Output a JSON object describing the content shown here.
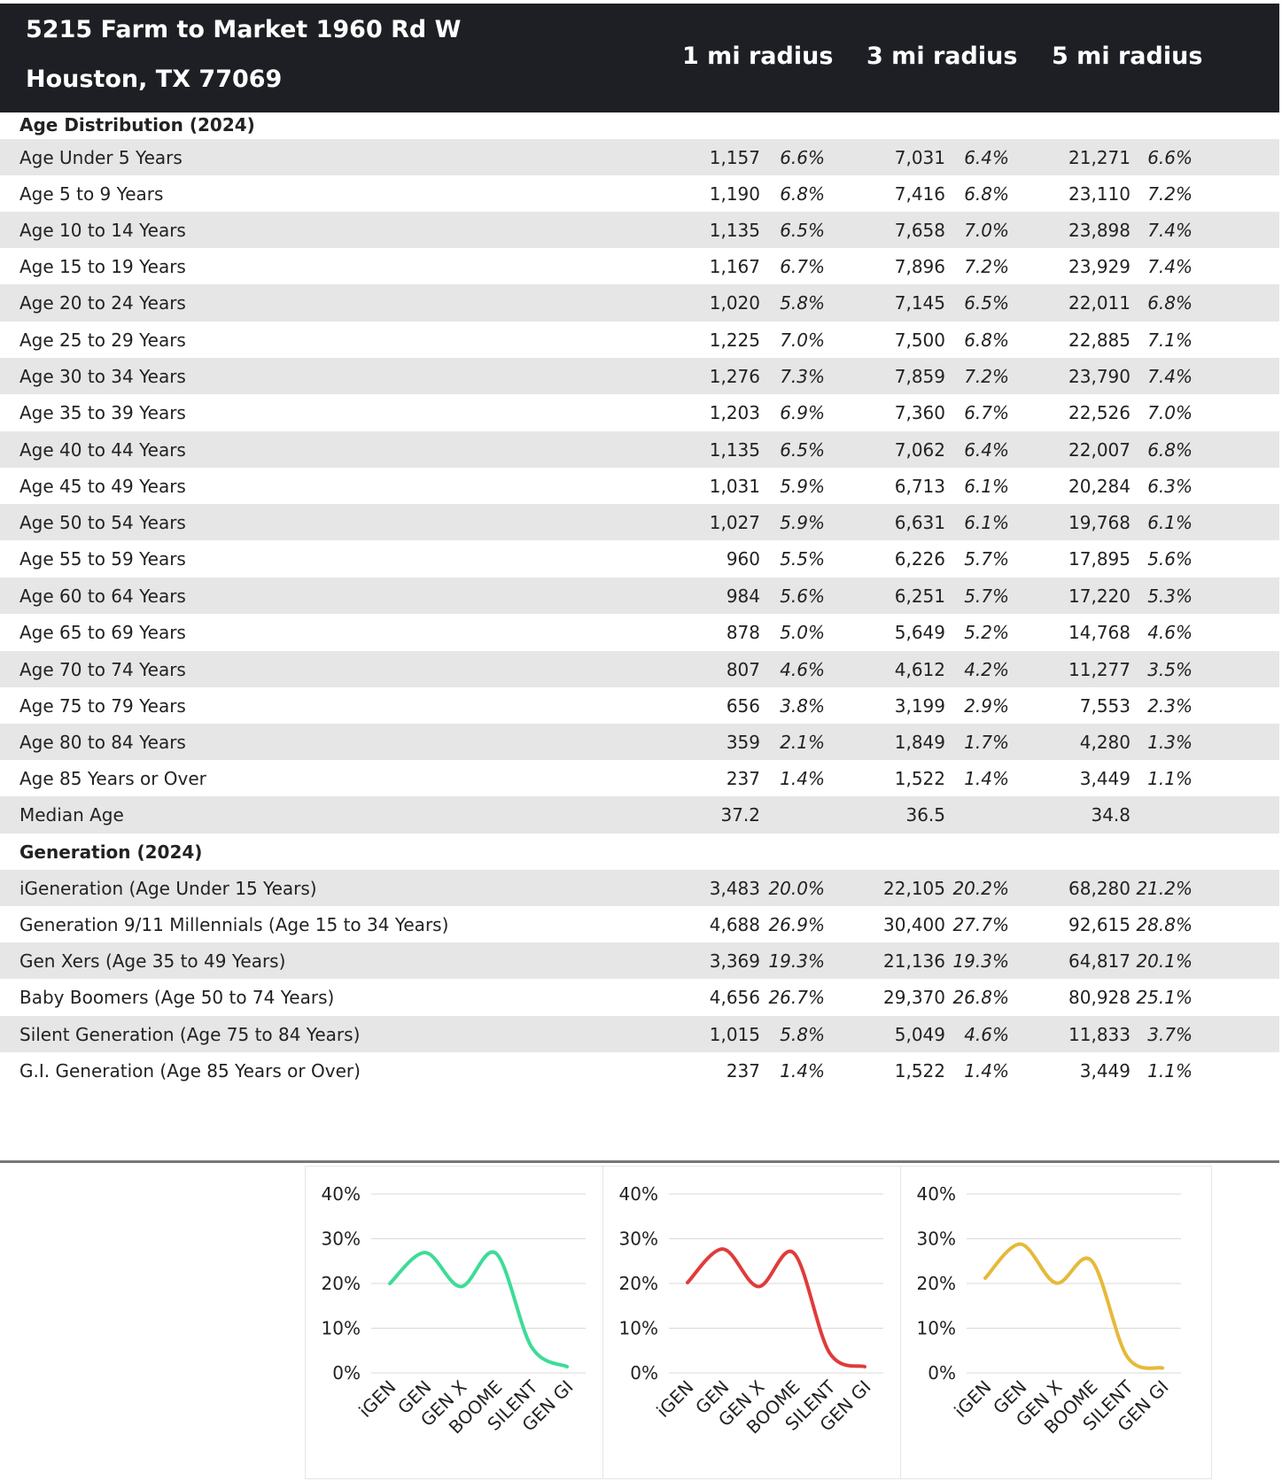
{
  "header": {
    "address_line1": "5215 Farm to Market 1960 Rd W",
    "address_line2": "Houston, TX 77069",
    "columns": [
      "1 mi radius",
      "3 mi radius",
      "5 mi radius"
    ]
  },
  "sections": [
    {
      "title": "Age Distribution (2024)",
      "rows": [
        {
          "label": "Age Under 5 Years",
          "values": [
            [
              "1,157",
              "6.6%"
            ],
            [
              "7,031",
              "6.4%"
            ],
            [
              "21,271",
              "6.6%"
            ]
          ]
        },
        {
          "label": "Age 5 to 9 Years",
          "values": [
            [
              "1,190",
              "6.8%"
            ],
            [
              "7,416",
              "6.8%"
            ],
            [
              "23,110",
              "7.2%"
            ]
          ]
        },
        {
          "label": "Age 10 to 14 Years",
          "values": [
            [
              "1,135",
              "6.5%"
            ],
            [
              "7,658",
              "7.0%"
            ],
            [
              "23,898",
              "7.4%"
            ]
          ]
        },
        {
          "label": "Age 15 to 19 Years",
          "values": [
            [
              "1,167",
              "6.7%"
            ],
            [
              "7,896",
              "7.2%"
            ],
            [
              "23,929",
              "7.4%"
            ]
          ]
        },
        {
          "label": "Age 20 to 24 Years",
          "values": [
            [
              "1,020",
              "5.8%"
            ],
            [
              "7,145",
              "6.5%"
            ],
            [
              "22,011",
              "6.8%"
            ]
          ]
        },
        {
          "label": "Age 25 to 29 Years",
          "values": [
            [
              "1,225",
              "7.0%"
            ],
            [
              "7,500",
              "6.8%"
            ],
            [
              "22,885",
              "7.1%"
            ]
          ]
        },
        {
          "label": "Age 30 to 34 Years",
          "values": [
            [
              "1,276",
              "7.3%"
            ],
            [
              "7,859",
              "7.2%"
            ],
            [
              "23,790",
              "7.4%"
            ]
          ]
        },
        {
          "label": "Age 35 to 39 Years",
          "values": [
            [
              "1,203",
              "6.9%"
            ],
            [
              "7,360",
              "6.7%"
            ],
            [
              "22,526",
              "7.0%"
            ]
          ]
        },
        {
          "label": "Age 40 to 44 Years",
          "values": [
            [
              "1,135",
              "6.5%"
            ],
            [
              "7,062",
              "6.4%"
            ],
            [
              "22,007",
              "6.8%"
            ]
          ]
        },
        {
          "label": "Age 45 to 49 Years",
          "values": [
            [
              "1,031",
              "5.9%"
            ],
            [
              "6,713",
              "6.1%"
            ],
            [
              "20,284",
              "6.3%"
            ]
          ]
        },
        {
          "label": "Age 50 to 54 Years",
          "values": [
            [
              "1,027",
              "5.9%"
            ],
            [
              "6,631",
              "6.1%"
            ],
            [
              "19,768",
              "6.1%"
            ]
          ]
        },
        {
          "label": "Age 55 to 59 Years",
          "values": [
            [
              "960",
              "5.5%"
            ],
            [
              "6,226",
              "5.7%"
            ],
            [
              "17,895",
              "5.6%"
            ]
          ]
        },
        {
          "label": "Age 60 to 64 Years",
          "values": [
            [
              "984",
              "5.6%"
            ],
            [
              "6,251",
              "5.7%"
            ],
            [
              "17,220",
              "5.3%"
            ]
          ]
        },
        {
          "label": "Age 65 to 69 Years",
          "values": [
            [
              "878",
              "5.0%"
            ],
            [
              "5,649",
              "5.2%"
            ],
            [
              "14,768",
              "4.6%"
            ]
          ]
        },
        {
          "label": "Age 70 to 74 Years",
          "values": [
            [
              "807",
              "4.6%"
            ],
            [
              "4,612",
              "4.2%"
            ],
            [
              "11,277",
              "3.5%"
            ]
          ]
        },
        {
          "label": "Age 75 to 79 Years",
          "values": [
            [
              "656",
              "3.8%"
            ],
            [
              "3,199",
              "2.9%"
            ],
            [
              "7,553",
              "2.3%"
            ]
          ]
        },
        {
          "label": "Age 80 to 84 Years",
          "values": [
            [
              "359",
              "2.1%"
            ],
            [
              "1,849",
              "1.7%"
            ],
            [
              "4,280",
              "1.3%"
            ]
          ]
        },
        {
          "label": "Age 85 Years or Over",
          "values": [
            [
              "237",
              "1.4%"
            ],
            [
              "1,522",
              "1.4%"
            ],
            [
              "3,449",
              "1.1%"
            ]
          ]
        },
        {
          "label": "Median Age",
          "values": [
            [
              "37.2",
              ""
            ],
            [
              "36.5",
              ""
            ],
            [
              "34.8",
              ""
            ]
          ]
        }
      ]
    },
    {
      "title": "Generation (2024)",
      "rows": [
        {
          "label": "iGeneration (Age Under 15 Years)",
          "values": [
            [
              "3,483",
              "20.0%"
            ],
            [
              "22,105",
              "20.2%"
            ],
            [
              "68,280",
              "21.2%"
            ]
          ]
        },
        {
          "label": "Generation 9/11 Millennials (Age 15 to 34 Years)",
          "values": [
            [
              "4,688",
              "26.9%"
            ],
            [
              "30,400",
              "27.7%"
            ],
            [
              "92,615",
              "28.8%"
            ]
          ]
        },
        {
          "label": "Gen Xers (Age 35 to 49 Years)",
          "values": [
            [
              "3,369",
              "19.3%"
            ],
            [
              "21,136",
              "19.3%"
            ],
            [
              "64,817",
              "20.1%"
            ]
          ]
        },
        {
          "label": "Baby Boomers (Age 50 to 74 Years)",
          "values": [
            [
              "4,656",
              "26.7%"
            ],
            [
              "29,370",
              "26.8%"
            ],
            [
              "80,928",
              "25.1%"
            ]
          ]
        },
        {
          "label": "Silent Generation (Age 75 to 84 Years)",
          "values": [
            [
              "1,015",
              "5.8%"
            ],
            [
              "5,049",
              "4.6%"
            ],
            [
              "11,833",
              "3.7%"
            ]
          ]
        },
        {
          "label": "G.I. Generation (Age 85 Years or Over)",
          "values": [
            [
              "237",
              "1.4%"
            ],
            [
              "1,522",
              "1.4%"
            ],
            [
              "3,449",
              "1.1%"
            ]
          ]
        }
      ]
    }
  ],
  "chart_data": [
    {
      "type": "line",
      "categories": [
        "iGEN",
        "GEN",
        "GEN X",
        "BOOME",
        "SILENT",
        "GEN GI"
      ],
      "values": [
        20.0,
        26.9,
        19.3,
        26.7,
        5.8,
        1.4
      ],
      "ylim": [
        0,
        40
      ],
      "yticks": [
        "0%",
        "10%",
        "20%",
        "30%",
        "40%"
      ],
      "color": "#3ddc97",
      "grid": true
    },
    {
      "type": "line",
      "categories": [
        "iGEN",
        "GEN",
        "GEN X",
        "BOOME",
        "SILENT",
        "GEN GI"
      ],
      "values": [
        20.2,
        27.7,
        19.3,
        26.8,
        4.6,
        1.4
      ],
      "ylim": [
        0,
        40
      ],
      "yticks": [
        "0%",
        "10%",
        "20%",
        "30%",
        "40%"
      ],
      "color": "#e03b3b",
      "grid": true
    },
    {
      "type": "line",
      "categories": [
        "iGEN",
        "GEN",
        "GEN X",
        "BOOME",
        "SILENT",
        "GEN GI"
      ],
      "values": [
        21.2,
        28.8,
        20.1,
        25.1,
        3.7,
        1.1
      ],
      "ylim": [
        0,
        40
      ],
      "yticks": [
        "0%",
        "10%",
        "20%",
        "30%",
        "40%"
      ],
      "color": "#e6b93a",
      "grid": true
    }
  ]
}
